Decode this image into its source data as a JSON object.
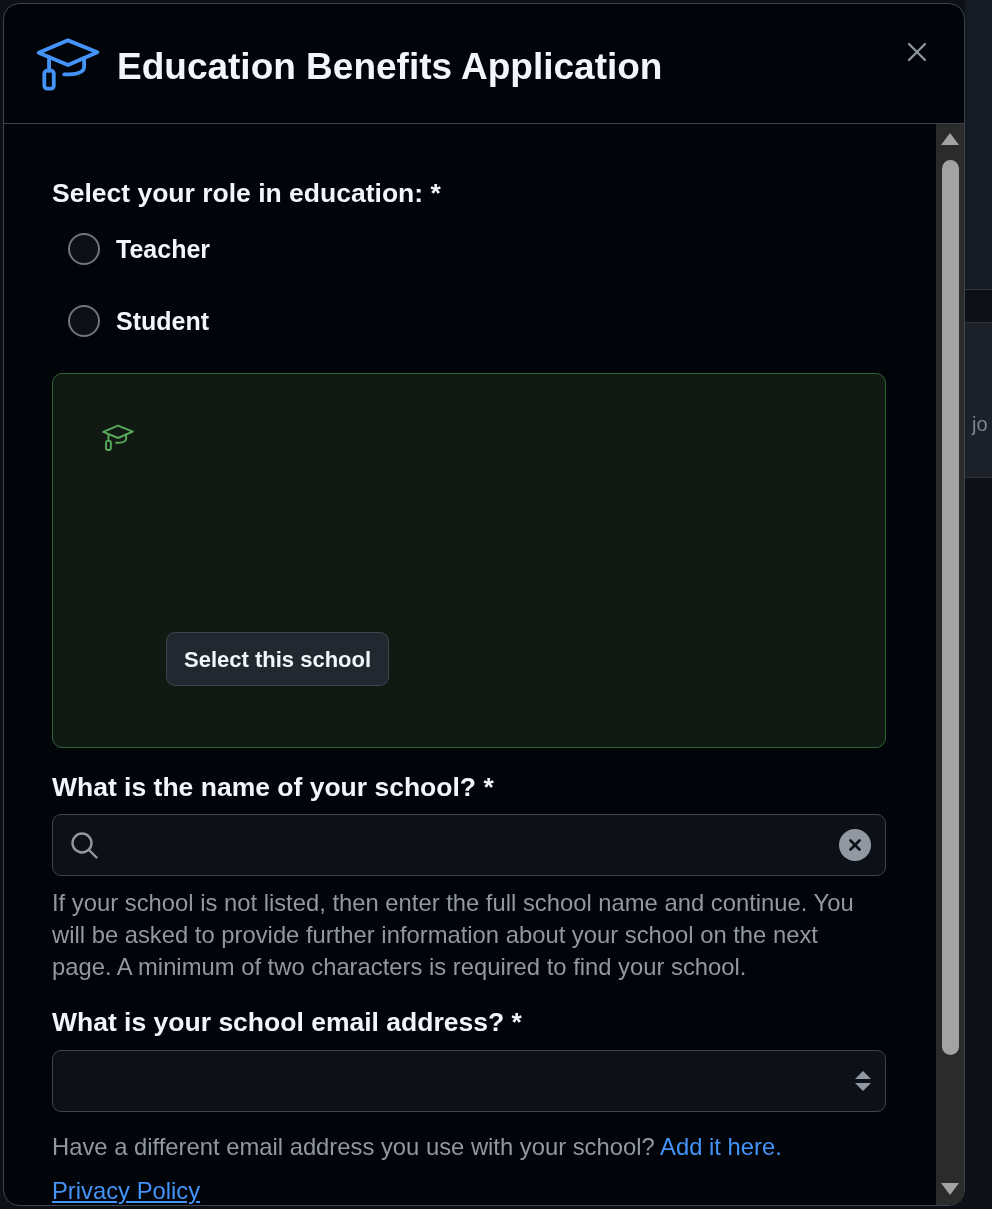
{
  "dialog": {
    "title": "Education Benefits Application"
  },
  "role": {
    "label": "Select your role in education: *",
    "options": [
      {
        "label": "Teacher",
        "selected": false
      },
      {
        "label": "Student",
        "selected": false
      }
    ]
  },
  "school_card": {
    "button": "Select this school"
  },
  "school_name": {
    "label": "What is the name of your school? *",
    "help": "If your school is not listed, then enter the full school name and continue. You will be asked to provide further information about your school on the next page. A minimum of two characters is required to find your school."
  },
  "school_email": {
    "label": "What is your school email address? *",
    "help": "Have a different email address you use with your school?",
    "link": "Add it here."
  },
  "privacy_link": "Privacy Policy",
  "background": {
    "text": "jo"
  }
}
